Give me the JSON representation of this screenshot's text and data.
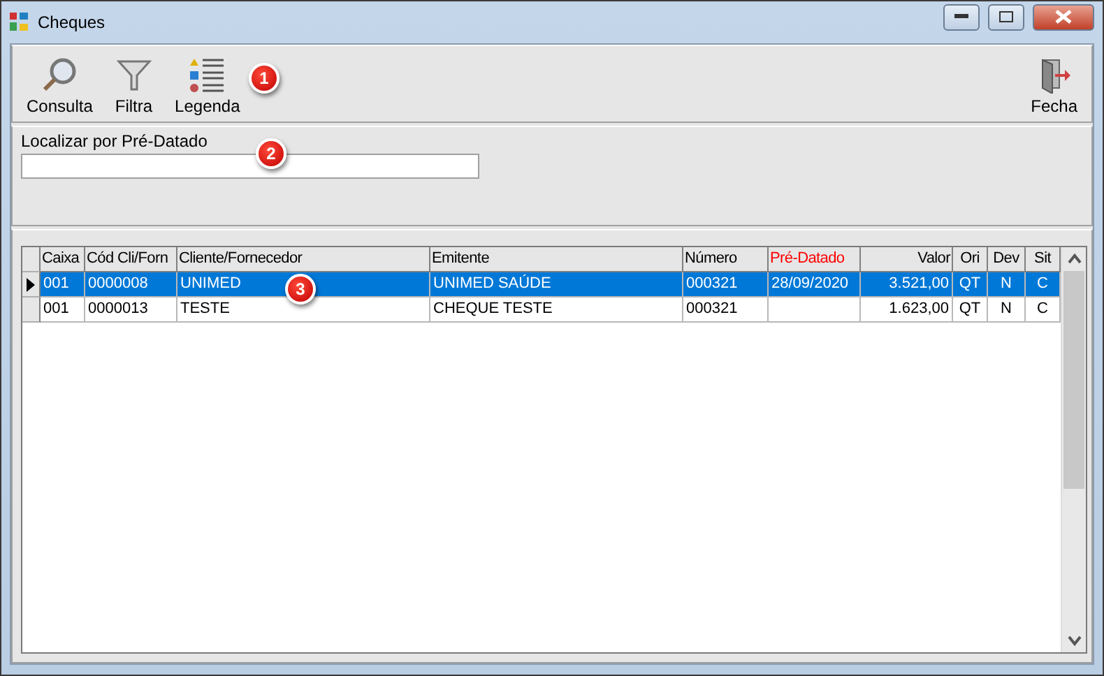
{
  "window": {
    "title": "Cheques"
  },
  "toolbar": {
    "buttons": [
      {
        "label": "Consulta",
        "kind": "search"
      },
      {
        "label": "Filtra",
        "kind": "filter"
      },
      {
        "label": "Legenda",
        "kind": "legend"
      }
    ],
    "close": {
      "label": "Fecha"
    }
  },
  "search": {
    "label": "Localizar por Pré-Datado"
  },
  "callouts": [
    "1",
    "2",
    "3"
  ],
  "table": {
    "columns": [
      {
        "label": "Caixa",
        "kind": "text",
        "emphasized": false
      },
      {
        "label": "Cód Cli/Forn",
        "kind": "text",
        "emphasized": false
      },
      {
        "label": "Cliente/Fornecedor",
        "kind": "text",
        "emphasized": false
      },
      {
        "label": "Emitente",
        "kind": "text",
        "emphasized": false
      },
      {
        "label": "Número",
        "kind": "text",
        "emphasized": false
      },
      {
        "label": "Pré-Datado",
        "kind": "text",
        "emphasized": true
      },
      {
        "label": "Valor",
        "kind": "amount",
        "emphasized": false
      },
      {
        "label": "Ori",
        "kind": "flag",
        "emphasized": false
      },
      {
        "label": "Dev",
        "kind": "flag",
        "emphasized": false
      },
      {
        "label": "Sit",
        "kind": "flag",
        "emphasized": false
      }
    ],
    "rows": [
      {
        "selected": true,
        "cells": [
          "001",
          "0000008",
          "UNIMED",
          "UNIMED SAÚDE",
          "000321",
          "28/09/2020",
          "3.521,00",
          "QT",
          "N",
          "C"
        ]
      },
      {
        "selected": false,
        "cells": [
          "001",
          "0000013",
          "TESTE",
          "CHEQUE TESTE",
          "000321",
          "",
          "1.623,00",
          "QT",
          "N",
          "C"
        ]
      }
    ]
  }
}
